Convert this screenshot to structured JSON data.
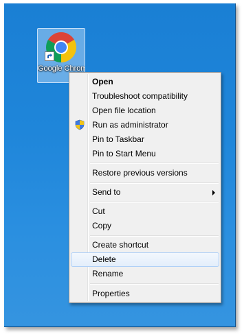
{
  "desktop": {
    "icon_label": "Google Chrom",
    "icon": "chrome-icon"
  },
  "context_menu": {
    "items": [
      {
        "label": "Open",
        "bold": true
      },
      {
        "label": "Troubleshoot compatibility"
      },
      {
        "label": "Open file location"
      },
      {
        "label": "Run as administrator",
        "icon": "uac-shield-icon"
      },
      {
        "label": "Pin to Taskbar"
      },
      {
        "label": "Pin to Start Menu"
      },
      {
        "label": "Restore previous versions"
      },
      {
        "label": "Send to",
        "submenu": true
      },
      {
        "label": "Cut"
      },
      {
        "label": "Copy"
      },
      {
        "label": "Create shortcut"
      },
      {
        "label": "Delete",
        "highlighted": true
      },
      {
        "label": "Rename"
      },
      {
        "label": "Properties"
      }
    ]
  },
  "colors": {
    "desktop_background": "#1f86da",
    "menu_background": "#f0f0f0",
    "menu_highlight_border": "#aecff7"
  }
}
